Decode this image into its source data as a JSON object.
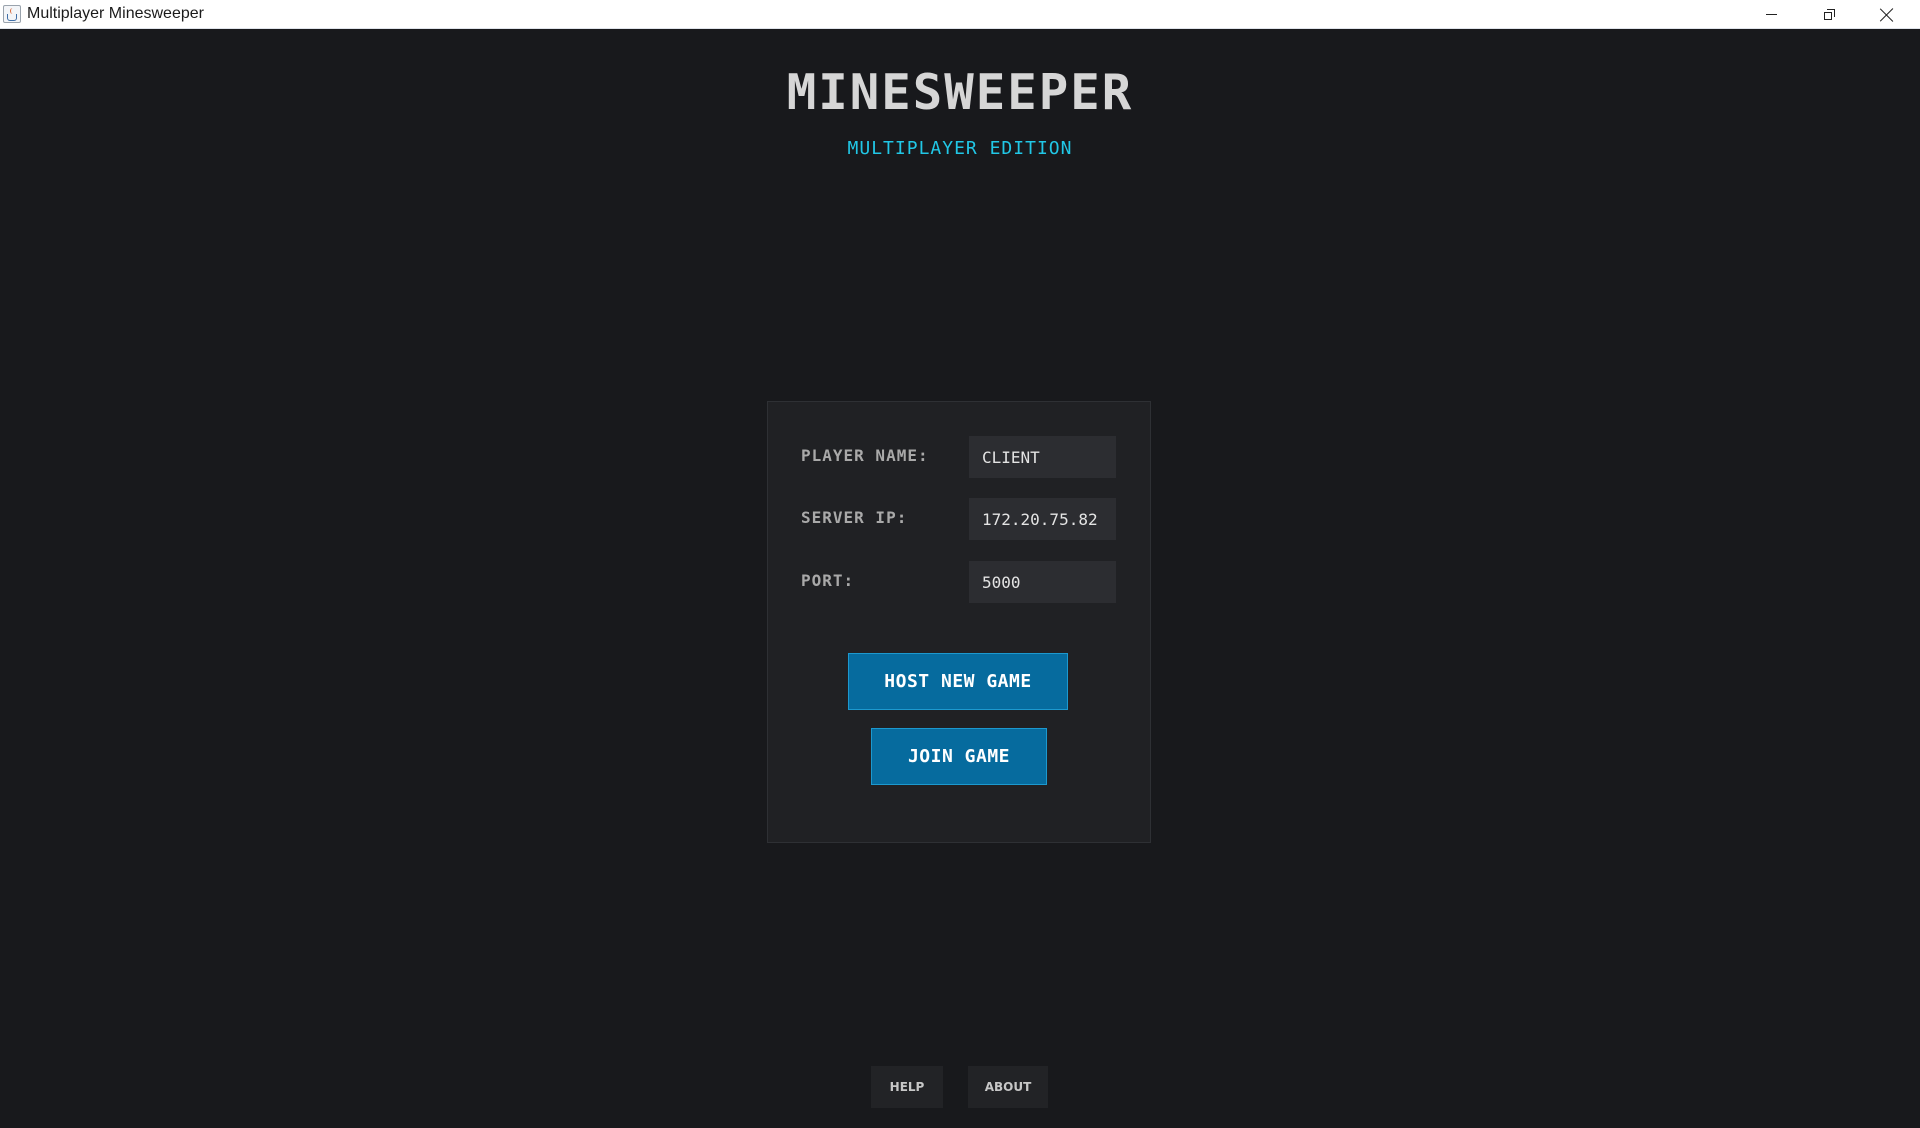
{
  "window": {
    "title": "Multiplayer Minesweeper",
    "icon": "java-app-icon",
    "controls": [
      "minimize-icon",
      "restore-icon",
      "close-icon"
    ]
  },
  "header": {
    "title": "MINESWEEPER",
    "subtitle": "MULTIPLAYER EDITION"
  },
  "connection": {
    "player_name_label": "PLAYER NAME:",
    "player_name_value": "CLIENT",
    "server_ip_label": "SERVER IP:",
    "server_ip_value": "172.20.75.82",
    "port_label": "PORT:",
    "port_value": "5000"
  },
  "actions": {
    "host_label": "HOST NEW GAME",
    "join_label": "JOIN GAME"
  },
  "footer": {
    "help_label": "HELP",
    "about_label": "ABOUT"
  },
  "colors": {
    "background": "#18191c",
    "panel": "#202124",
    "accent": "#21c7e6",
    "button": "#066b9e"
  }
}
